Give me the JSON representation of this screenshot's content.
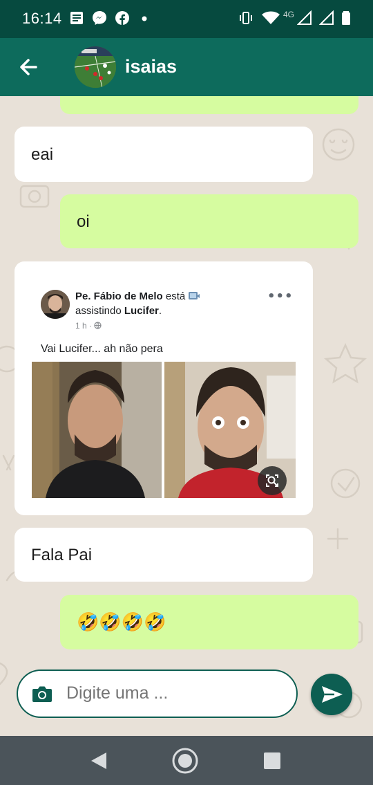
{
  "status_bar": {
    "time": "16:14",
    "network": "4G",
    "icons": [
      "notes-icon",
      "messenger-icon",
      "facebook-icon",
      "dot-icon",
      "vibrate-icon",
      "wifi-icon",
      "signal-icon",
      "signal-icon",
      "battery-icon"
    ]
  },
  "header": {
    "contact_name": "isaias",
    "back_icon": "arrow-left-icon",
    "avatar": "soccer-field-photo"
  },
  "colors": {
    "status_bar": "#064a3f",
    "app_bar": "#0d6b5c",
    "outgoing_bubble": "#d6fca0",
    "incoming_bubble": "#ffffff",
    "wallpaper": "#e8e1d8",
    "accent": "#0d5e52",
    "nav_bar": "#4b545a"
  },
  "messages": [
    {
      "direction": "outgoing",
      "text": ""
    },
    {
      "direction": "incoming",
      "text": "eai"
    },
    {
      "direction": "outgoing",
      "text": "oi"
    },
    {
      "direction": "incoming",
      "type": "image"
    },
    {
      "direction": "incoming",
      "text": "Fala Pai"
    },
    {
      "direction": "outgoing",
      "text": "🤣🤣🤣🤣"
    }
  ],
  "shared_post": {
    "author": "Pe. Fábio de Melo",
    "status_prefix": "está",
    "status_line2_prefix": "assistindo",
    "status_target": "Lucifer",
    "status_suffix": ".",
    "time": "1 h",
    "more": "•••",
    "caption": "Vai Lucifer... ah não pera"
  },
  "composer": {
    "placeholder": "Digite uma ...",
    "camera_icon": "camera-icon",
    "send_icon": "send-icon"
  },
  "nav": {
    "icons": [
      "back-triangle-icon",
      "home-circle-icon",
      "recents-square-icon"
    ]
  }
}
